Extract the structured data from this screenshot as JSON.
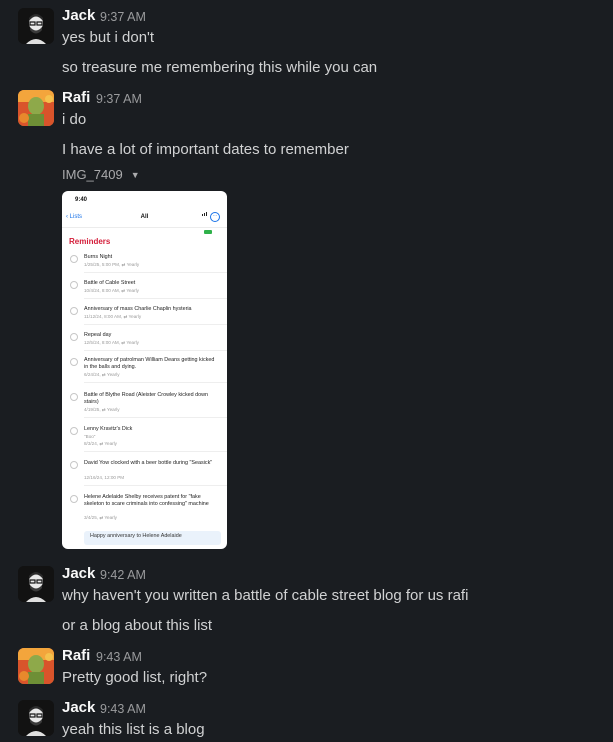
{
  "messages": [
    {
      "author": "Jack",
      "time": "9:37 AM",
      "lines": [
        "yes but i don't",
        "so treasure me remembering this while you can"
      ]
    },
    {
      "author": "Rafi",
      "time": "9:37 AM",
      "lines": [
        "i do",
        "I have a lot of important dates to remember"
      ],
      "attachment": {
        "name": "IMG_7409"
      }
    },
    {
      "author": "Jack",
      "time": "9:42 AM",
      "lines": [
        "why haven't you written a battle of cable street blog for us rafi",
        "or a blog about this list"
      ]
    },
    {
      "author": "Rafi",
      "time": "9:43 AM",
      "lines": [
        "Pretty good list, right?"
      ]
    },
    {
      "author": "Jack",
      "time": "9:43 AM",
      "lines": [
        "yeah this list is a blog"
      ]
    }
  ],
  "screenshot": {
    "status_time": "9:40",
    "back_label": "Lists",
    "nav_title": "All",
    "more_icon": "ellipsis-circle-icon",
    "heading": "Reminders",
    "heading_color": "#d41e3a",
    "items": [
      {
        "title": "Burns Night",
        "meta": "1/25/25, 5:00 PM, ⇄ Yearly"
      },
      {
        "title": "Battle of Cable Street",
        "meta": "10/4/24, 8:00 AM, ⇄ Yearly"
      },
      {
        "title": "Anniversary of mass Charlie Chaplin hysteria",
        "meta": "11/12/24, 8:00 AM, ⇄ Yearly"
      },
      {
        "title": "Repeal day",
        "meta": "12/5/24, 8:00 AM, ⇄ Yearly"
      },
      {
        "title": "Anniversary of patrolman William Deans getting kicked in the balls and dying.",
        "meta": "6/24/24, ⇄ Yearly"
      },
      {
        "title": "Battle of Blythe Road (Aleister Crowley kicked down stairs)",
        "meta": "4/19/25, ⇄ Yearly"
      },
      {
        "title": "Lenny Kravitz's Dick",
        "meta": "\"Boo\"",
        "meta2": "8/3/24, ⇄ Yearly"
      },
      {
        "title": "David Yow clocked with a beer bottle during \"Seasick\"",
        "meta": "12/16/24, 12:00 PM"
      },
      {
        "title": "Helene Adelaide Shelby receives patent for \"fake skeleton to scare criminals into confessing\" machine",
        "meta": "3/4/25, ⇄ Yearly"
      }
    ],
    "bottom_text": "Happy anniversary to Helene Adelaide"
  }
}
